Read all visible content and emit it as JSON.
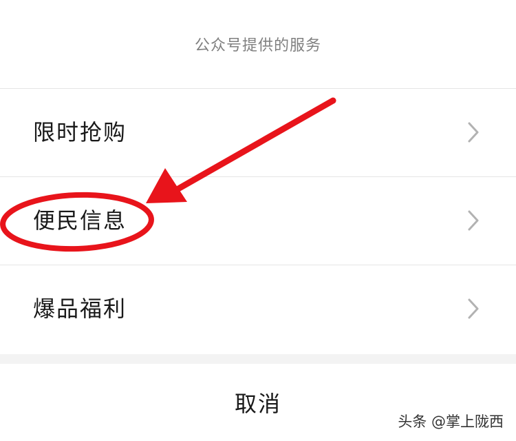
{
  "sheet": {
    "title": "公众号提供的服务",
    "items": [
      {
        "label": "限时抢购",
        "icon": "chevron-right-icon"
      },
      {
        "label": "便民信息",
        "icon": "chevron-right-icon"
      },
      {
        "label": "爆品福利",
        "icon": "chevron-right-icon"
      }
    ],
    "cancel_label": "取消"
  },
  "annotation": {
    "color": "#e8141b",
    "highlighted_item": "便民信息",
    "shapes": [
      "arrow",
      "ellipse"
    ]
  },
  "watermark": {
    "text": "头条 @掌上陇西"
  }
}
